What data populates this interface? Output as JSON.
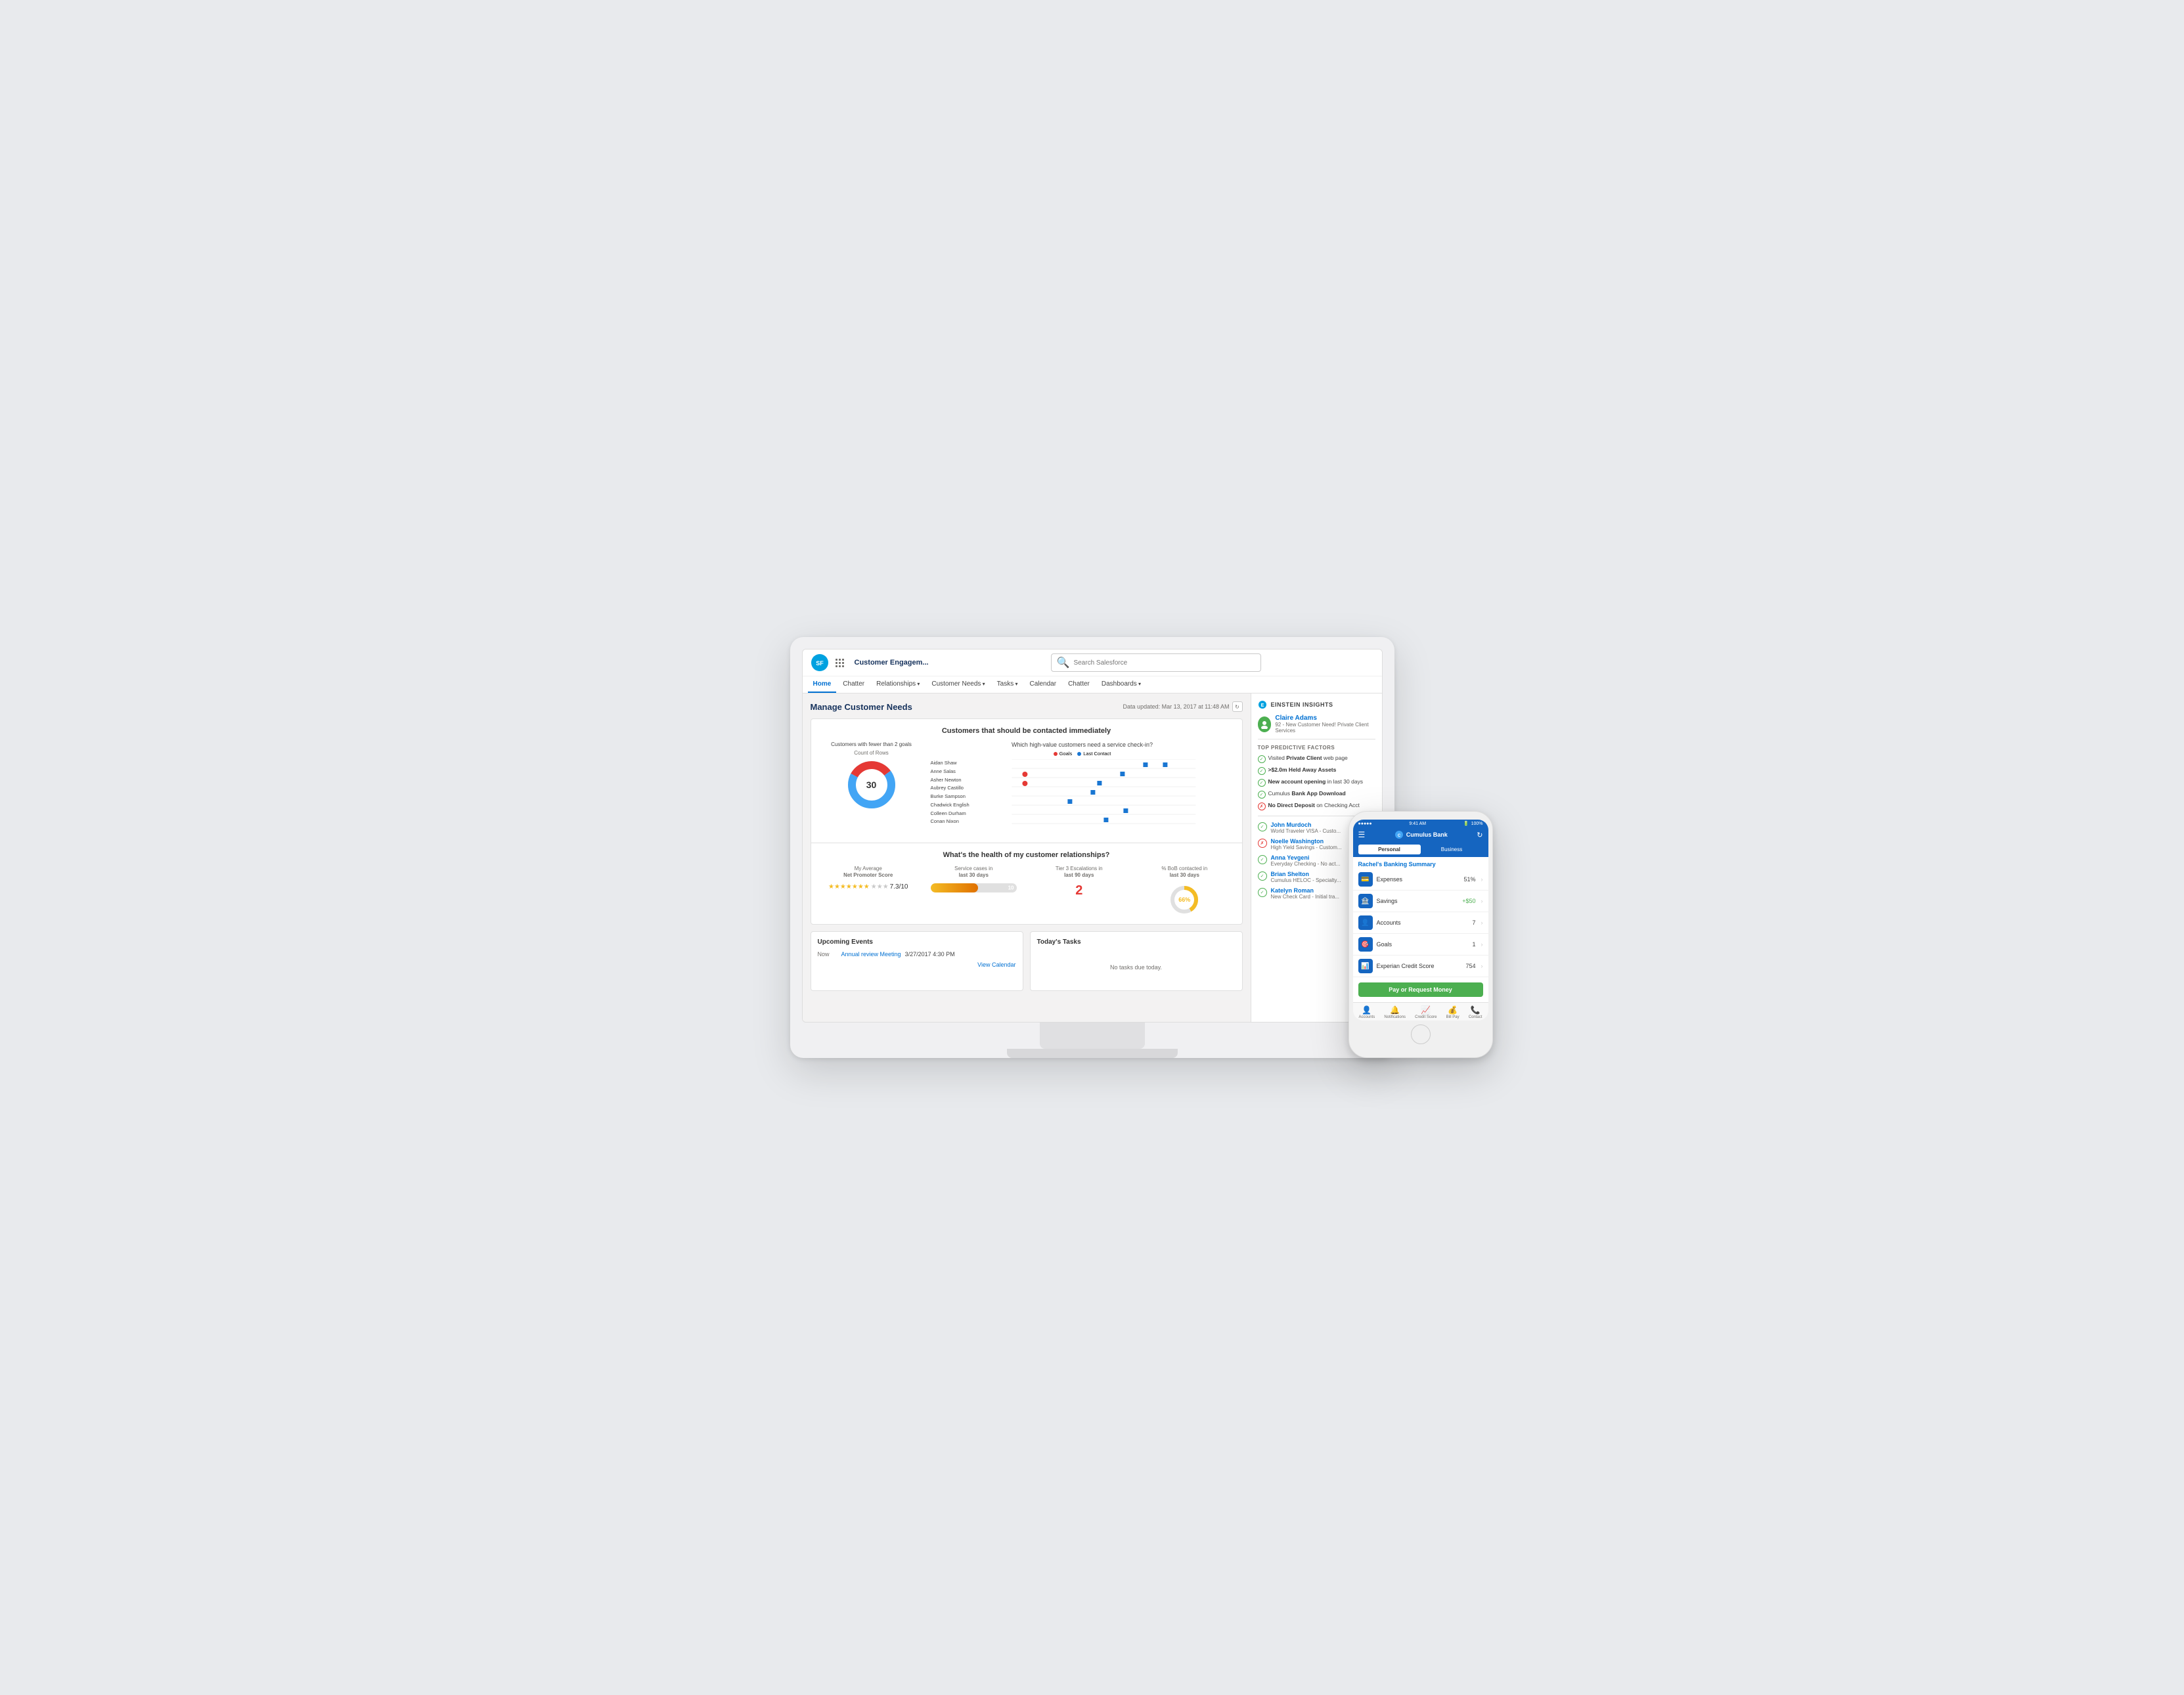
{
  "page": {
    "bg_color": "#e8eaed"
  },
  "monitor": {
    "app_name": "Customer Engagem...",
    "search_placeholder": "Search Salesforce",
    "data_updated": "Data updated: Mar 13, 2017 at 11:48 AM",
    "page_title": "Manage Customer Needs"
  },
  "nav": {
    "items": [
      {
        "label": "Home",
        "active": true,
        "has_arrow": false
      },
      {
        "label": "Chatter",
        "active": false,
        "has_arrow": false
      },
      {
        "label": "Relationships",
        "active": false,
        "has_arrow": true
      },
      {
        "label": "Customer Needs",
        "active": false,
        "has_arrow": true
      },
      {
        "label": "Tasks",
        "active": false,
        "has_arrow": true
      },
      {
        "label": "Calendar",
        "active": false,
        "has_arrow": false
      },
      {
        "label": "Chatter",
        "active": false,
        "has_arrow": false
      },
      {
        "label": "Dashboards",
        "active": false,
        "has_arrow": true
      }
    ]
  },
  "chart": {
    "main_title": "Customers that should be contacted immediately",
    "donut": {
      "title": "Customers with fewer than 2 goals",
      "subtitle": "Count of Rows",
      "number": "30"
    },
    "scatter": {
      "title": "Which high-value customers need a service check-in?",
      "legend_goals": "Goals",
      "legend_contact": "Last Contact",
      "names": [
        "Aidan Shaw",
        "Anne Salas",
        "Asher Newton",
        "Aubrey Castillo",
        "Burke Sampson",
        "Chadwick English",
        "Colleen Durham",
        "Conan Nixon"
      ]
    },
    "health_title": "What's the health of my customer relationships?",
    "metrics": {
      "nps_label": "My Average Net Promoter Score",
      "nps_value": "7.3/10",
      "service_label": "Service cases in last 30 days",
      "service_value": "10",
      "escalation_label": "Tier 3 Escalations in last 90 days",
      "escalation_value": "2",
      "bob_label": "% BoB contacted in last 30 days",
      "bob_value": "66%"
    }
  },
  "events": {
    "title": "Upcoming Events",
    "items": [
      {
        "time": "Now",
        "name": "Annual review Meeting",
        "date": "3/27/2017 4:30 PM"
      }
    ],
    "view_calendar": "View Calendar"
  },
  "tasks": {
    "title": "Today's Tasks",
    "empty": "No tasks due today."
  },
  "einstein": {
    "title": "EINSTEIN INSIGHTS",
    "person": {
      "name": "Claire Adams",
      "detail": "92 - New Customer Need! Private Client Services"
    },
    "predictive_title": "TOP PREDICTIVE FACTORS",
    "factors": [
      {
        "text": "Visited Private Client web page",
        "positive": true
      },
      {
        "text": ">$2.0m Held Away Assets",
        "positive": true
      },
      {
        "text": "New account opening in last 30 days",
        "positive": true
      },
      {
        "text": "Cumulus Bank App Download",
        "positive": true
      },
      {
        "text": "No Direct Deposit on Checking Acct",
        "positive": false
      }
    ],
    "contacts": [
      {
        "name": "John Murdoch",
        "detail": "World Traveler VISA - Custo...",
        "positive": true
      },
      {
        "name": "Noelle Washington",
        "detail": "High Yield Savings - Custom...",
        "warning": true
      },
      {
        "name": "Anna Yevgeni",
        "detail": "Everyday Checking - No act...",
        "positive": true
      },
      {
        "name": "Brian Shelton",
        "detail": "Cumulus HELOC - Specialty...",
        "positive": true
      },
      {
        "name": "Katelyn Roman",
        "detail": "New Check Card - Initial tra...",
        "positive": true
      }
    ]
  },
  "phone": {
    "time": "9:41 AM",
    "battery": "100%",
    "signal": "●●●●●",
    "bank_name": "Cumulus Bank",
    "tab_personal": "Personal",
    "tab_business": "Business",
    "summary_title": "Rachel's Banking Summary",
    "items": [
      {
        "icon": "💳",
        "label": "Expenses",
        "value": "51%",
        "positive": false
      },
      {
        "icon": "🏦",
        "label": "Savings",
        "value": "+$50",
        "positive": true
      },
      {
        "icon": "👤",
        "label": "Accounts",
        "value": "7",
        "positive": false
      },
      {
        "icon": "🎯",
        "label": "Goals",
        "value": "1",
        "positive": false
      },
      {
        "icon": "📊",
        "label": "Experian Credit Score",
        "value": "754",
        "positive": false
      }
    ],
    "pay_button": "Pay or Request Money",
    "nav_items": [
      {
        "icon": "👤",
        "label": "Accounts"
      },
      {
        "icon": "🔔",
        "label": "Notifications"
      },
      {
        "icon": "📈",
        "label": "Credit Score"
      },
      {
        "icon": "💰",
        "label": "Bill Pay"
      },
      {
        "icon": "📞",
        "label": "Contact"
      }
    ]
  }
}
